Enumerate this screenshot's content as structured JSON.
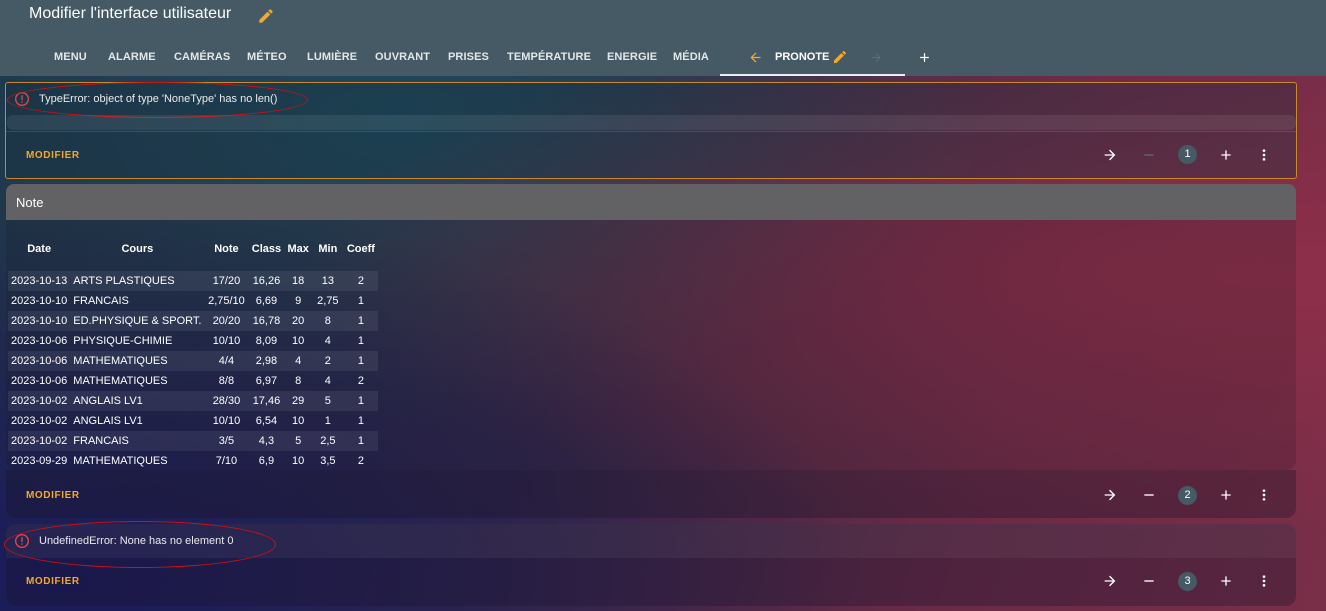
{
  "header": {
    "title": "Modifier l'interface utilisateur",
    "tabs": [
      "MENU",
      "ALARME",
      "CAMÉRAS",
      "MÉTEO",
      "LUMIÈRE",
      "OUVRANT",
      "PRISES",
      "TEMPÉRATURE",
      "ENERGIE",
      "MÉDIA"
    ],
    "active_tab": "PRONOTE"
  },
  "colors": {
    "accent": "#f4a72a",
    "header": "#455a64",
    "error": "#d11010"
  },
  "card1": {
    "error": "TypeError: object of type 'NoneType' has no len()",
    "modifier": "MODIFIER",
    "position": "1"
  },
  "card2": {
    "title": "Note",
    "columns": [
      "Date",
      "Cours",
      "Note",
      "Class",
      "Max",
      "Min",
      "Coeff"
    ],
    "rows": [
      [
        "2023-10-13",
        "ARTS PLASTIQUES",
        "17/20",
        "16,26",
        "18",
        "13",
        "2"
      ],
      [
        "2023-10-10",
        "FRANCAIS",
        "2,75/10",
        "6,69",
        "9",
        "2,75",
        "1"
      ],
      [
        "2023-10-10",
        "ED.PHYSIQUE & SPORT.",
        "20/20",
        "16,78",
        "20",
        "8",
        "1"
      ],
      [
        "2023-10-06",
        "PHYSIQUE-CHIMIE",
        "10/10",
        "8,09",
        "10",
        "4",
        "1"
      ],
      [
        "2023-10-06",
        "MATHEMATIQUES",
        "4/4",
        "2,98",
        "4",
        "2",
        "1"
      ],
      [
        "2023-10-06",
        "MATHEMATIQUES",
        "8/8",
        "6,97",
        "8",
        "4",
        "2"
      ],
      [
        "2023-10-02",
        "ANGLAIS LV1",
        "28/30",
        "17,46",
        "29",
        "5",
        "1"
      ],
      [
        "2023-10-02",
        "ANGLAIS LV1",
        "10/10",
        "6,54",
        "10",
        "1",
        "1"
      ],
      [
        "2023-10-02",
        "FRANCAIS",
        "3/5",
        "4,3",
        "5",
        "2,5",
        "1"
      ],
      [
        "2023-09-29",
        "MATHEMATIQUES",
        "7/10",
        "6,9",
        "10",
        "3,5",
        "2"
      ]
    ],
    "modifier": "MODIFIER",
    "position": "2"
  },
  "card3": {
    "error": "UndefinedError: None has no element 0",
    "modifier": "MODIFIER",
    "position": "3"
  }
}
